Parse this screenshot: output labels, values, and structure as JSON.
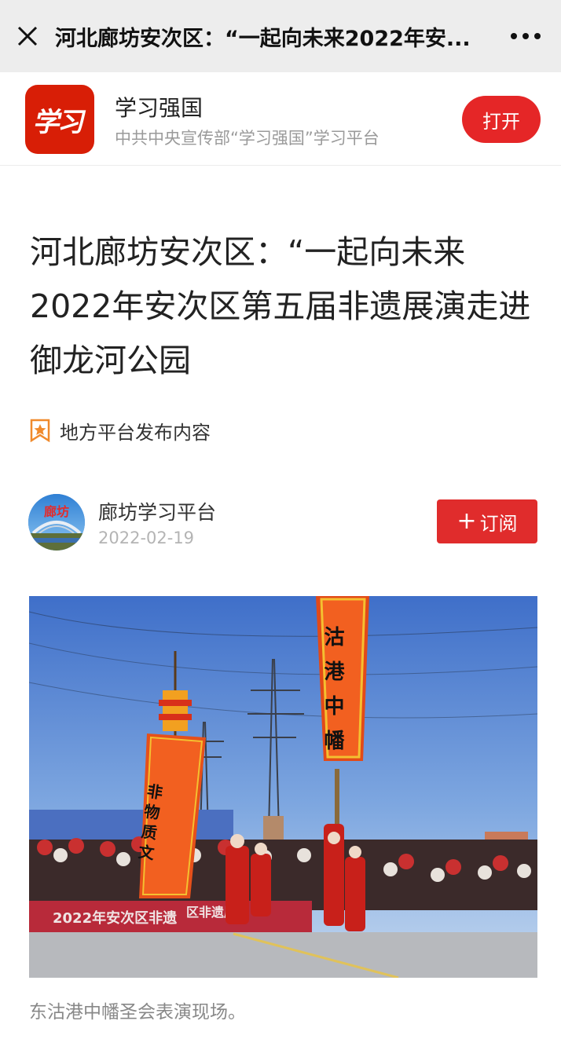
{
  "navbar": {
    "title": "河北廊坊安次区：“一起向未来2022年安...",
    "close_icon": "close-icon",
    "more_icon": "more-dots-icon"
  },
  "app_banner": {
    "logo_text": "学习",
    "name": "学习强国",
    "description": "中共中央宣传部“学习强国”学习平台",
    "open_label": "打开",
    "brand_color": "#d81e06"
  },
  "article": {
    "title": "河北廊坊安次区：“一起向未来2022年安次区第五届非遗展演走进御龙河公园",
    "source_label": "地方平台发布内容",
    "author": {
      "name": "廊坊学习平台",
      "date": "2022-02-19",
      "avatar_text": "廊坊"
    },
    "subscribe_label": "订阅",
    "photo": {
      "banner_left": "非物质文",
      "banner_right": "沽港中幡",
      "stage_text": "2022年安次区非遗",
      "stage_text_right": "区非遗展"
    },
    "caption": "东沽港中幡圣会表演现场。"
  }
}
